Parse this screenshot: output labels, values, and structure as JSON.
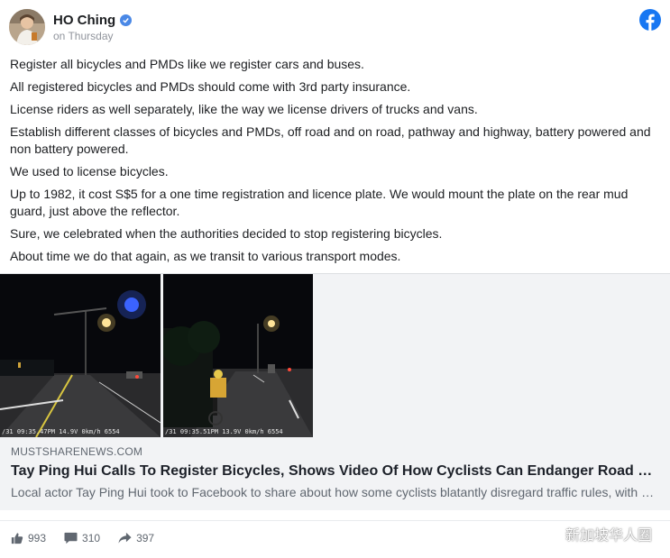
{
  "post": {
    "author": "HO Ching",
    "timestamp": "on Thursday",
    "paragraphs": [
      "Register all bicycles and PMDs like we register cars and buses.",
      "All registered bicycles and PMDs should come with 3rd party insurance.",
      "License riders as well separately, like the way we license drivers of trucks and vans.",
      "Establish different classes of bicycles and PMDs, off road and on road, pathway and highway, battery powered and non battery powered.",
      "We used to license bicycles.",
      "Up to 1982, it cost S$5 for a one time registration and licence plate. We would mount the plate on the rear mud guard, just above the reflector.",
      "Sure, we celebrated when the authorities decided to stop registering bicycles.",
      "About time we do that again, as we transit to various transport modes."
    ]
  },
  "link_card": {
    "domain": "MUSTSHARENEWS.COM",
    "title": "Tay Ping Hui Calls To Register Bicycles, Shows Video Of How Cyclists Can Endanger Road Users",
    "description": "Local actor Tay Ping Hui took to Facebook to share about how some cyclists blatantly disregard traffic rules, with a video to prove it",
    "frame_left_overlay": "/31 09:35.47PM 14.9V  0km/h 6554",
    "frame_right_overlay": "/31 09:35.51PM 13.9V  0km/h 6554"
  },
  "actions": {
    "likes": "993",
    "comments": "310",
    "shares": "397"
  },
  "watermark": "新加坡华人圈",
  "icons": {
    "verified": "verified-badge-icon",
    "facebook": "facebook-logo-icon",
    "like": "thumbs-up-icon",
    "comment": "comment-icon",
    "share": "share-arrow-icon",
    "watermark": "wechat-icon"
  },
  "colors": {
    "facebook_blue": "#1877f2",
    "verified_blue": "#4a88e6",
    "muted_text": "#606770",
    "card_bg": "#f2f3f5"
  }
}
